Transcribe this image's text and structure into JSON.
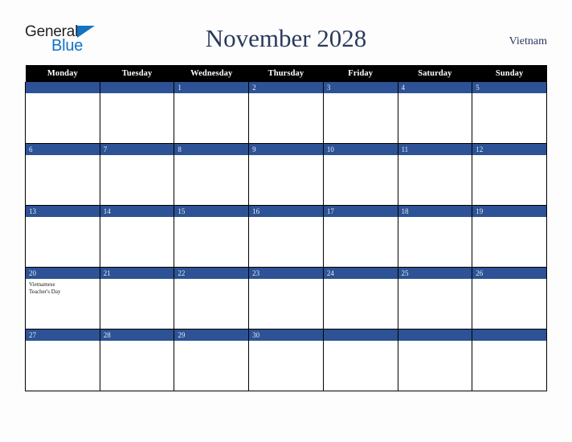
{
  "brand": {
    "name_part1": "General",
    "name_part2": "Blue",
    "triangle_icon": "triangle-icon",
    "accent_color": "#1273c4",
    "text_color": "#231f20"
  },
  "header": {
    "title": "November 2028",
    "country": "Vietnam",
    "title_color": "#2b3a5c"
  },
  "theme": {
    "header_row_bg": "#000000",
    "header_row_text": "#ffffff",
    "date_bar_bg": "#2d5295",
    "date_bar_text": "#e8ecf4",
    "cell_bg": "#ffffff",
    "grid_line": "#000000",
    "page_bg": "#fdfdfd"
  },
  "calendar": {
    "month": "November",
    "year": "2028",
    "weekday_headers": [
      "Monday",
      "Tuesday",
      "Wednesday",
      "Thursday",
      "Friday",
      "Saturday",
      "Sunday"
    ],
    "weeks": [
      [
        {
          "day": "",
          "events": []
        },
        {
          "day": "",
          "events": []
        },
        {
          "day": "1",
          "events": []
        },
        {
          "day": "2",
          "events": []
        },
        {
          "day": "3",
          "events": []
        },
        {
          "day": "4",
          "events": []
        },
        {
          "day": "5",
          "events": []
        }
      ],
      [
        {
          "day": "6",
          "events": []
        },
        {
          "day": "7",
          "events": []
        },
        {
          "day": "8",
          "events": []
        },
        {
          "day": "9",
          "events": []
        },
        {
          "day": "10",
          "events": []
        },
        {
          "day": "11",
          "events": []
        },
        {
          "day": "12",
          "events": []
        }
      ],
      [
        {
          "day": "13",
          "events": []
        },
        {
          "day": "14",
          "events": []
        },
        {
          "day": "15",
          "events": []
        },
        {
          "day": "16",
          "events": []
        },
        {
          "day": "17",
          "events": []
        },
        {
          "day": "18",
          "events": []
        },
        {
          "day": "19",
          "events": []
        }
      ],
      [
        {
          "day": "20",
          "events": [
            "Vietnamese",
            "Teacher's Day"
          ]
        },
        {
          "day": "21",
          "events": []
        },
        {
          "day": "22",
          "events": []
        },
        {
          "day": "23",
          "events": []
        },
        {
          "day": "24",
          "events": []
        },
        {
          "day": "25",
          "events": []
        },
        {
          "day": "26",
          "events": []
        }
      ],
      [
        {
          "day": "27",
          "events": []
        },
        {
          "day": "28",
          "events": []
        },
        {
          "day": "29",
          "events": []
        },
        {
          "day": "30",
          "events": []
        },
        {
          "day": "",
          "events": []
        },
        {
          "day": "",
          "events": []
        },
        {
          "day": "",
          "events": []
        }
      ]
    ]
  }
}
